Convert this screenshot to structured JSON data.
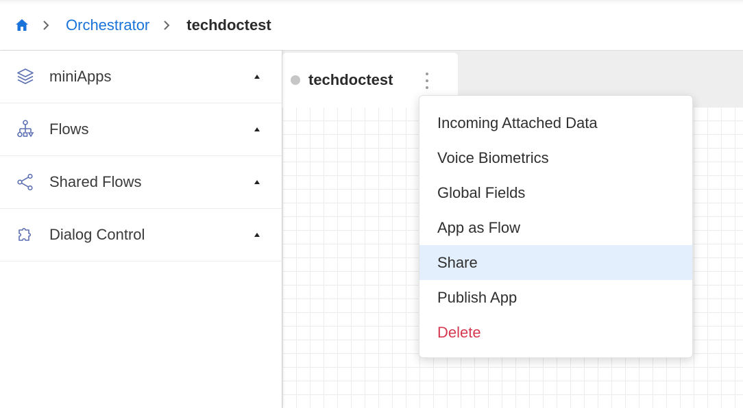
{
  "breadcrumb": {
    "home_icon": "home-icon",
    "items": [
      {
        "label": "Orchestrator"
      },
      {
        "label": "techdoctest"
      }
    ]
  },
  "sidebar": {
    "items": [
      {
        "label": "miniApps",
        "icon": "layers-icon"
      },
      {
        "label": "Flows",
        "icon": "sitemap-icon"
      },
      {
        "label": "Shared Flows",
        "icon": "share-icon"
      },
      {
        "label": "Dialog Control",
        "icon": "puzzle-icon"
      }
    ]
  },
  "tab": {
    "label": "techdoctest",
    "status": "inactive"
  },
  "menu": {
    "items": [
      {
        "label": "Incoming Attached Data"
      },
      {
        "label": "Voice Biometrics"
      },
      {
        "label": "Global Fields"
      },
      {
        "label": "App as Flow"
      },
      {
        "label": "Share",
        "highlighted": true
      },
      {
        "label": "Publish App"
      },
      {
        "label": "Delete",
        "danger": true
      }
    ]
  },
  "colors": {
    "link": "#1a73d9",
    "icon": "#5b6fb3",
    "highlight": "#e3effc",
    "danger": "#d6394f"
  }
}
